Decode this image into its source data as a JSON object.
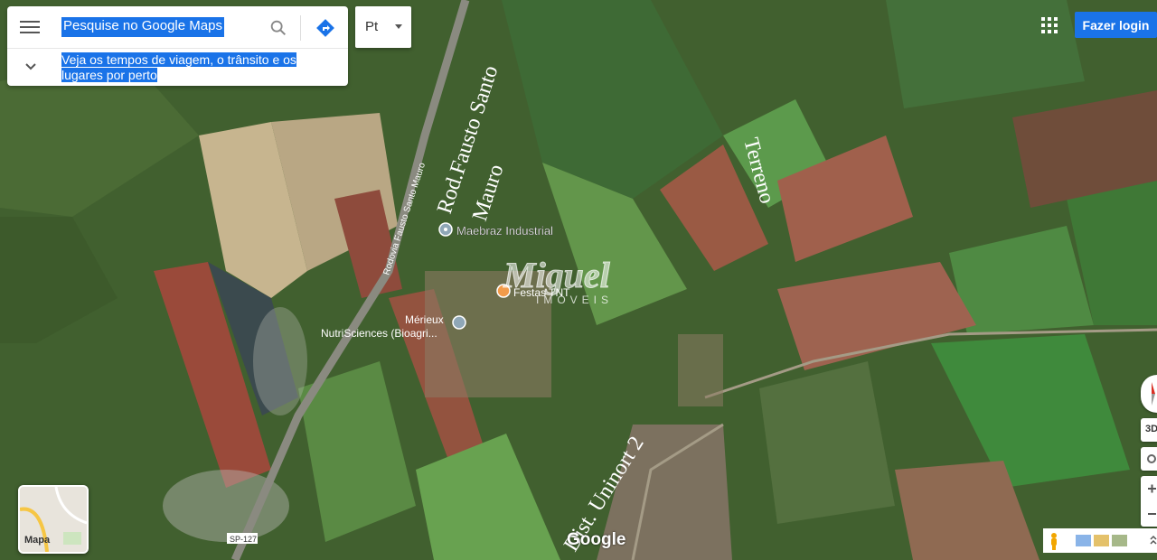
{
  "search": {
    "placeholder": "Pesquise no Google Maps",
    "hint": "Veja os tempos de viagem, o trânsito e os lugares por perto"
  },
  "language": {
    "selected": "Pt"
  },
  "account": {
    "login_label": "Fazer login"
  },
  "map": {
    "places": [
      {
        "name": "Maebraz Industrial",
        "icon": "place-pin-icon"
      },
      {
        "name": "Festas TNT",
        "icon": "food-pin-icon"
      },
      {
        "name": "Mérieux\nNutriSciences (Bioagri...",
        "line1": "Mérieux",
        "line2": "NutriSciences (Bioagri..."
      }
    ],
    "road_label": "Rodovia Fausto Santo Mauro",
    "route_shield": "SP-127",
    "annotations": {
      "road": {
        "line1": "Rod.Fausto Santo",
        "line2": "Mauro"
      },
      "terrain": "Terreno",
      "district": "Dist. Uninort 2"
    },
    "watermark": {
      "brand": "Miguel",
      "sub": "IMÓVEIS"
    }
  },
  "layers": {
    "label": "Mapa"
  },
  "attribution": {
    "logo": "Google"
  },
  "controls": {
    "tilt_label": "3D"
  },
  "colors": {
    "accent": "#1a73e8"
  }
}
